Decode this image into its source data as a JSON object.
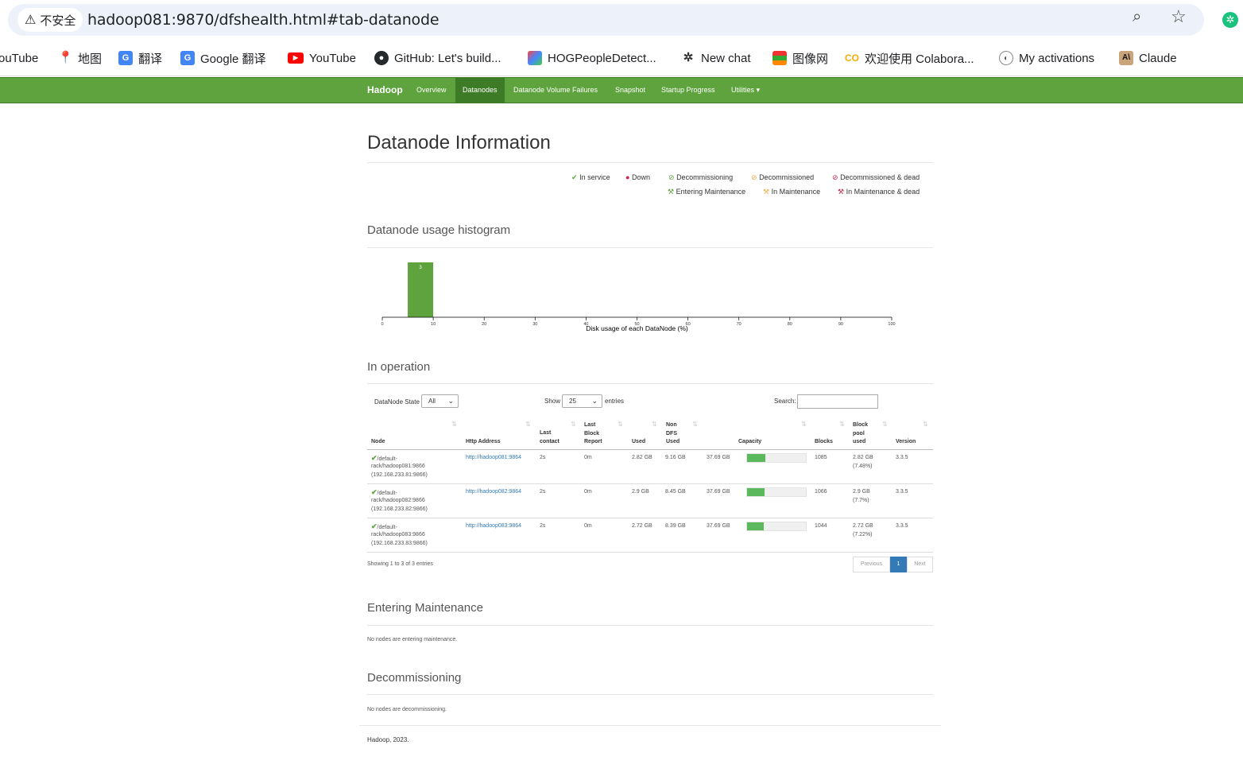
{
  "browser": {
    "security_label": "不安全",
    "url": "hadoop081:9870/dfshealth.html#tab-datanode",
    "bookmarks": [
      {
        "label": "ouTube",
        "icon": "youtube-icon"
      },
      {
        "label": "地图",
        "icon": "maps-icon"
      },
      {
        "label": "翻译",
        "icon": "translate-icon"
      },
      {
        "label": "Google 翻译",
        "icon": "translate-icon"
      },
      {
        "label": "YouTube",
        "icon": "youtube-icon"
      },
      {
        "label": "GitHub: Let's build...",
        "icon": "github-icon"
      },
      {
        "label": "HOGPeopleDetect...",
        "icon": "image-icon"
      },
      {
        "label": "New chat",
        "icon": "openai-icon"
      },
      {
        "label": "图像网",
        "icon": "imagenet-icon"
      },
      {
        "label": "欢迎使用 Colabora...",
        "icon": "colab-icon"
      },
      {
        "label": "My activations",
        "icon": "activations-icon"
      },
      {
        "label": "Claude",
        "icon": "anthropic-icon"
      }
    ]
  },
  "navbar": {
    "brand": "Hadoop",
    "items": [
      "Overview",
      "Datanodes",
      "Datanode Volume Failures",
      "Snapshot",
      "Startup Progress",
      "Utilities ▾"
    ],
    "active": "Datanodes"
  },
  "page_title": "Datanode Information",
  "legend": {
    "in_service": "In service",
    "down": "Down",
    "decommissioning": "Decommissioning",
    "decommissioned": "Decommissioned",
    "decommissioned_dead": "Decommissioned & dead",
    "entering_maintenance": "Entering Maintenance",
    "in_maintenance": "In Maintenance",
    "in_maintenance_dead": "In Maintenance & dead"
  },
  "histogram": {
    "title": "Datanode usage histogram",
    "chart_data": {
      "type": "bar",
      "xlabel": "Disk usage of each DataNode (%)",
      "xlim": [
        0,
        100
      ],
      "ticks": [
        "0",
        "10",
        "20",
        "30",
        "40",
        "50",
        "60",
        "70",
        "80",
        "90",
        "100"
      ],
      "bins": [
        {
          "from": 5,
          "to": 10,
          "count": 3
        }
      ]
    }
  },
  "in_operation": {
    "title": "In operation",
    "state_label": "DataNode State",
    "state_value": "All",
    "show_label": "Show",
    "show_value": "25",
    "entries_label": "entries",
    "search_label": "Search:",
    "headers": [
      "Node",
      "Http Address",
      "Last contact",
      "Last Block Report",
      "Used",
      "Non DFS Used",
      "Capacity",
      "Blocks",
      "Block pool used",
      "Version"
    ],
    "rows": [
      {
        "node1": "/default-",
        "node2": "rack/hadoop081:9866",
        "node3": "(192.168.233.81:9866)",
        "http": "http://hadoop081:9864",
        "last_contact": "2s",
        "last_report": "0m",
        "used": "2.82 GB",
        "non_dfs": "9.16 GB",
        "capacity": "37.69 GB",
        "usage_pct": 31,
        "blocks": "1085",
        "bp1": "2.82 GB",
        "bp2": "(7.48%)",
        "version": "3.3.5"
      },
      {
        "node1": "/default-",
        "node2": "rack/hadoop082:9866",
        "node3": "(192.168.233.82:9866)",
        "http": "http://hadoop082:9864",
        "last_contact": "2s",
        "last_report": "0m",
        "used": "2.9 GB",
        "non_dfs": "8.45 GB",
        "capacity": "37.69 GB",
        "usage_pct": 30,
        "blocks": "1066",
        "bp1": "2.9 GB",
        "bp2": "(7.7%)",
        "version": "3.3.5"
      },
      {
        "node1": "/default-",
        "node2": "rack/hadoop083:9866",
        "node3": "(192.168.233.83:9866)",
        "http": "http://hadoop083:9864",
        "last_contact": "2s",
        "last_report": "0m",
        "used": "2.72 GB",
        "non_dfs": "8.39 GB",
        "capacity": "37.69 GB",
        "usage_pct": 29,
        "blocks": "1044",
        "bp1": "2.72 GB",
        "bp2": "(7.22%)",
        "version": "3.3.5"
      }
    ],
    "showing": "Showing 1 to 3 of 3 entries",
    "pager": {
      "previous": "Previous",
      "current": "1",
      "next": "Next"
    }
  },
  "entering_maintenance": {
    "title": "Entering Maintenance",
    "note": "No nodes are entering maintenance."
  },
  "decommissioning": {
    "title": "Decommissioning",
    "note": "No nodes are decommissioning."
  },
  "footer": "Hadoop, 2023."
}
